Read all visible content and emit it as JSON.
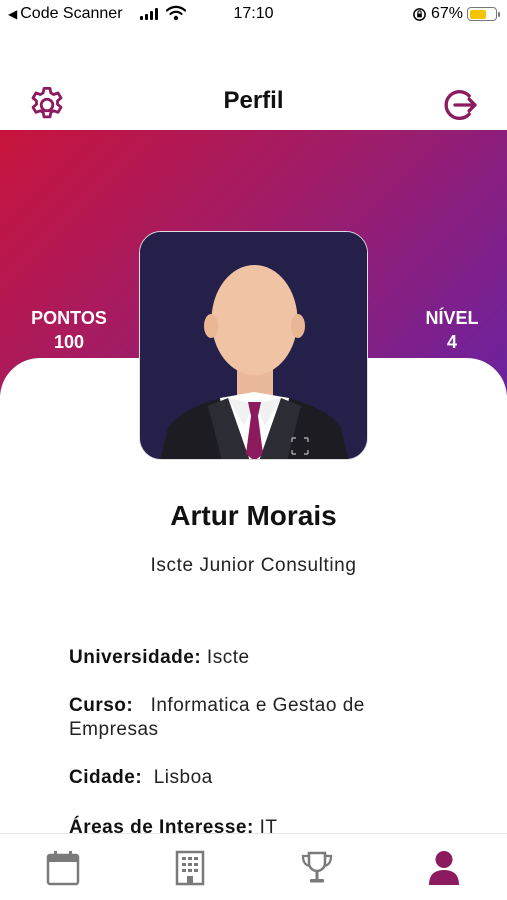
{
  "status_bar": {
    "back_app": "Code Scanner",
    "time": "17:10",
    "battery_percent": "67%",
    "battery_level": 0.67
  },
  "header": {
    "title": "Perfil",
    "settings_icon": "gear-icon",
    "logout_icon": "logout-icon"
  },
  "stats": {
    "points_label": "PONTOS",
    "points_value": "100",
    "level_label": "NÍVEL",
    "level_value": "4"
  },
  "profile": {
    "name": "Artur Morais",
    "organization": "Iscte Junior Consulting"
  },
  "details": {
    "university_label": "Universidade:",
    "university_value": " Iscte",
    "course_label": "Curso:",
    "course_value": "   Informatica e Gestao de Empresas",
    "city_label": "Cidade:",
    "city_value": "  Lisboa",
    "interests_label": "Áreas de Interesse:",
    "interests_value": " IT"
  },
  "tabbar": {
    "items": [
      "calendar-icon",
      "building-icon",
      "trophy-icon",
      "user-icon"
    ],
    "active": "user-icon"
  },
  "colors": {
    "accent": "#8b1a5e",
    "gradient_start": "#c8143c",
    "gradient_end": "#6a22a0",
    "inactive_icon": "#7a7a7a",
    "battery": "#f3c400"
  }
}
